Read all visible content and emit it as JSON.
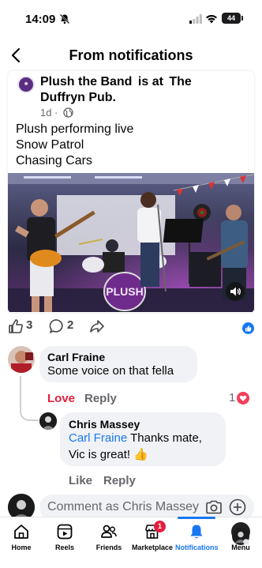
{
  "status_bar": {
    "time": "14:09",
    "battery": "44"
  },
  "header": {
    "title": "From notifications"
  },
  "post": {
    "author": "Plush the Band",
    "at_text": "is at",
    "place_line1": "The",
    "place_line2": "Duffryn Pub.",
    "time": "1d",
    "body": [
      "Plush performing live",
      "Snow Patrol",
      "Chasing Cars"
    ],
    "drum_logo": "PLUSH"
  },
  "reactions": {
    "likes": "3",
    "comments": "2"
  },
  "comments": [
    {
      "author": "Carl Fraine",
      "text": "Some voice on that fella",
      "love_label": "Love",
      "reply_label": "Reply",
      "love_count": "1"
    },
    {
      "author": "Chris Massey",
      "mention": "Carl Fraine",
      "text_line1": "Thanks mate,",
      "text_line2": "Vic is great! 👍",
      "like_label": "Like",
      "reply_label": "Reply"
    }
  ],
  "comment_input": {
    "placeholder": "Comment as Chris Massey"
  },
  "tabbar": {
    "tabs": [
      {
        "label": "Home",
        "icon": "home-icon"
      },
      {
        "label": "Reels",
        "icon": "reels-icon"
      },
      {
        "label": "Friends",
        "icon": "friends-icon"
      },
      {
        "label": "Marketplace",
        "icon": "marketplace-icon",
        "badge": "1"
      },
      {
        "label": "Notifications",
        "icon": "bell-icon",
        "active": true
      },
      {
        "label": "Menu",
        "icon": "menu-avatar"
      }
    ]
  },
  "colors": {
    "accent": "#1877f2",
    "love": "#e41e3f",
    "muted": "#65676b",
    "bubble": "#f0f2f5"
  }
}
